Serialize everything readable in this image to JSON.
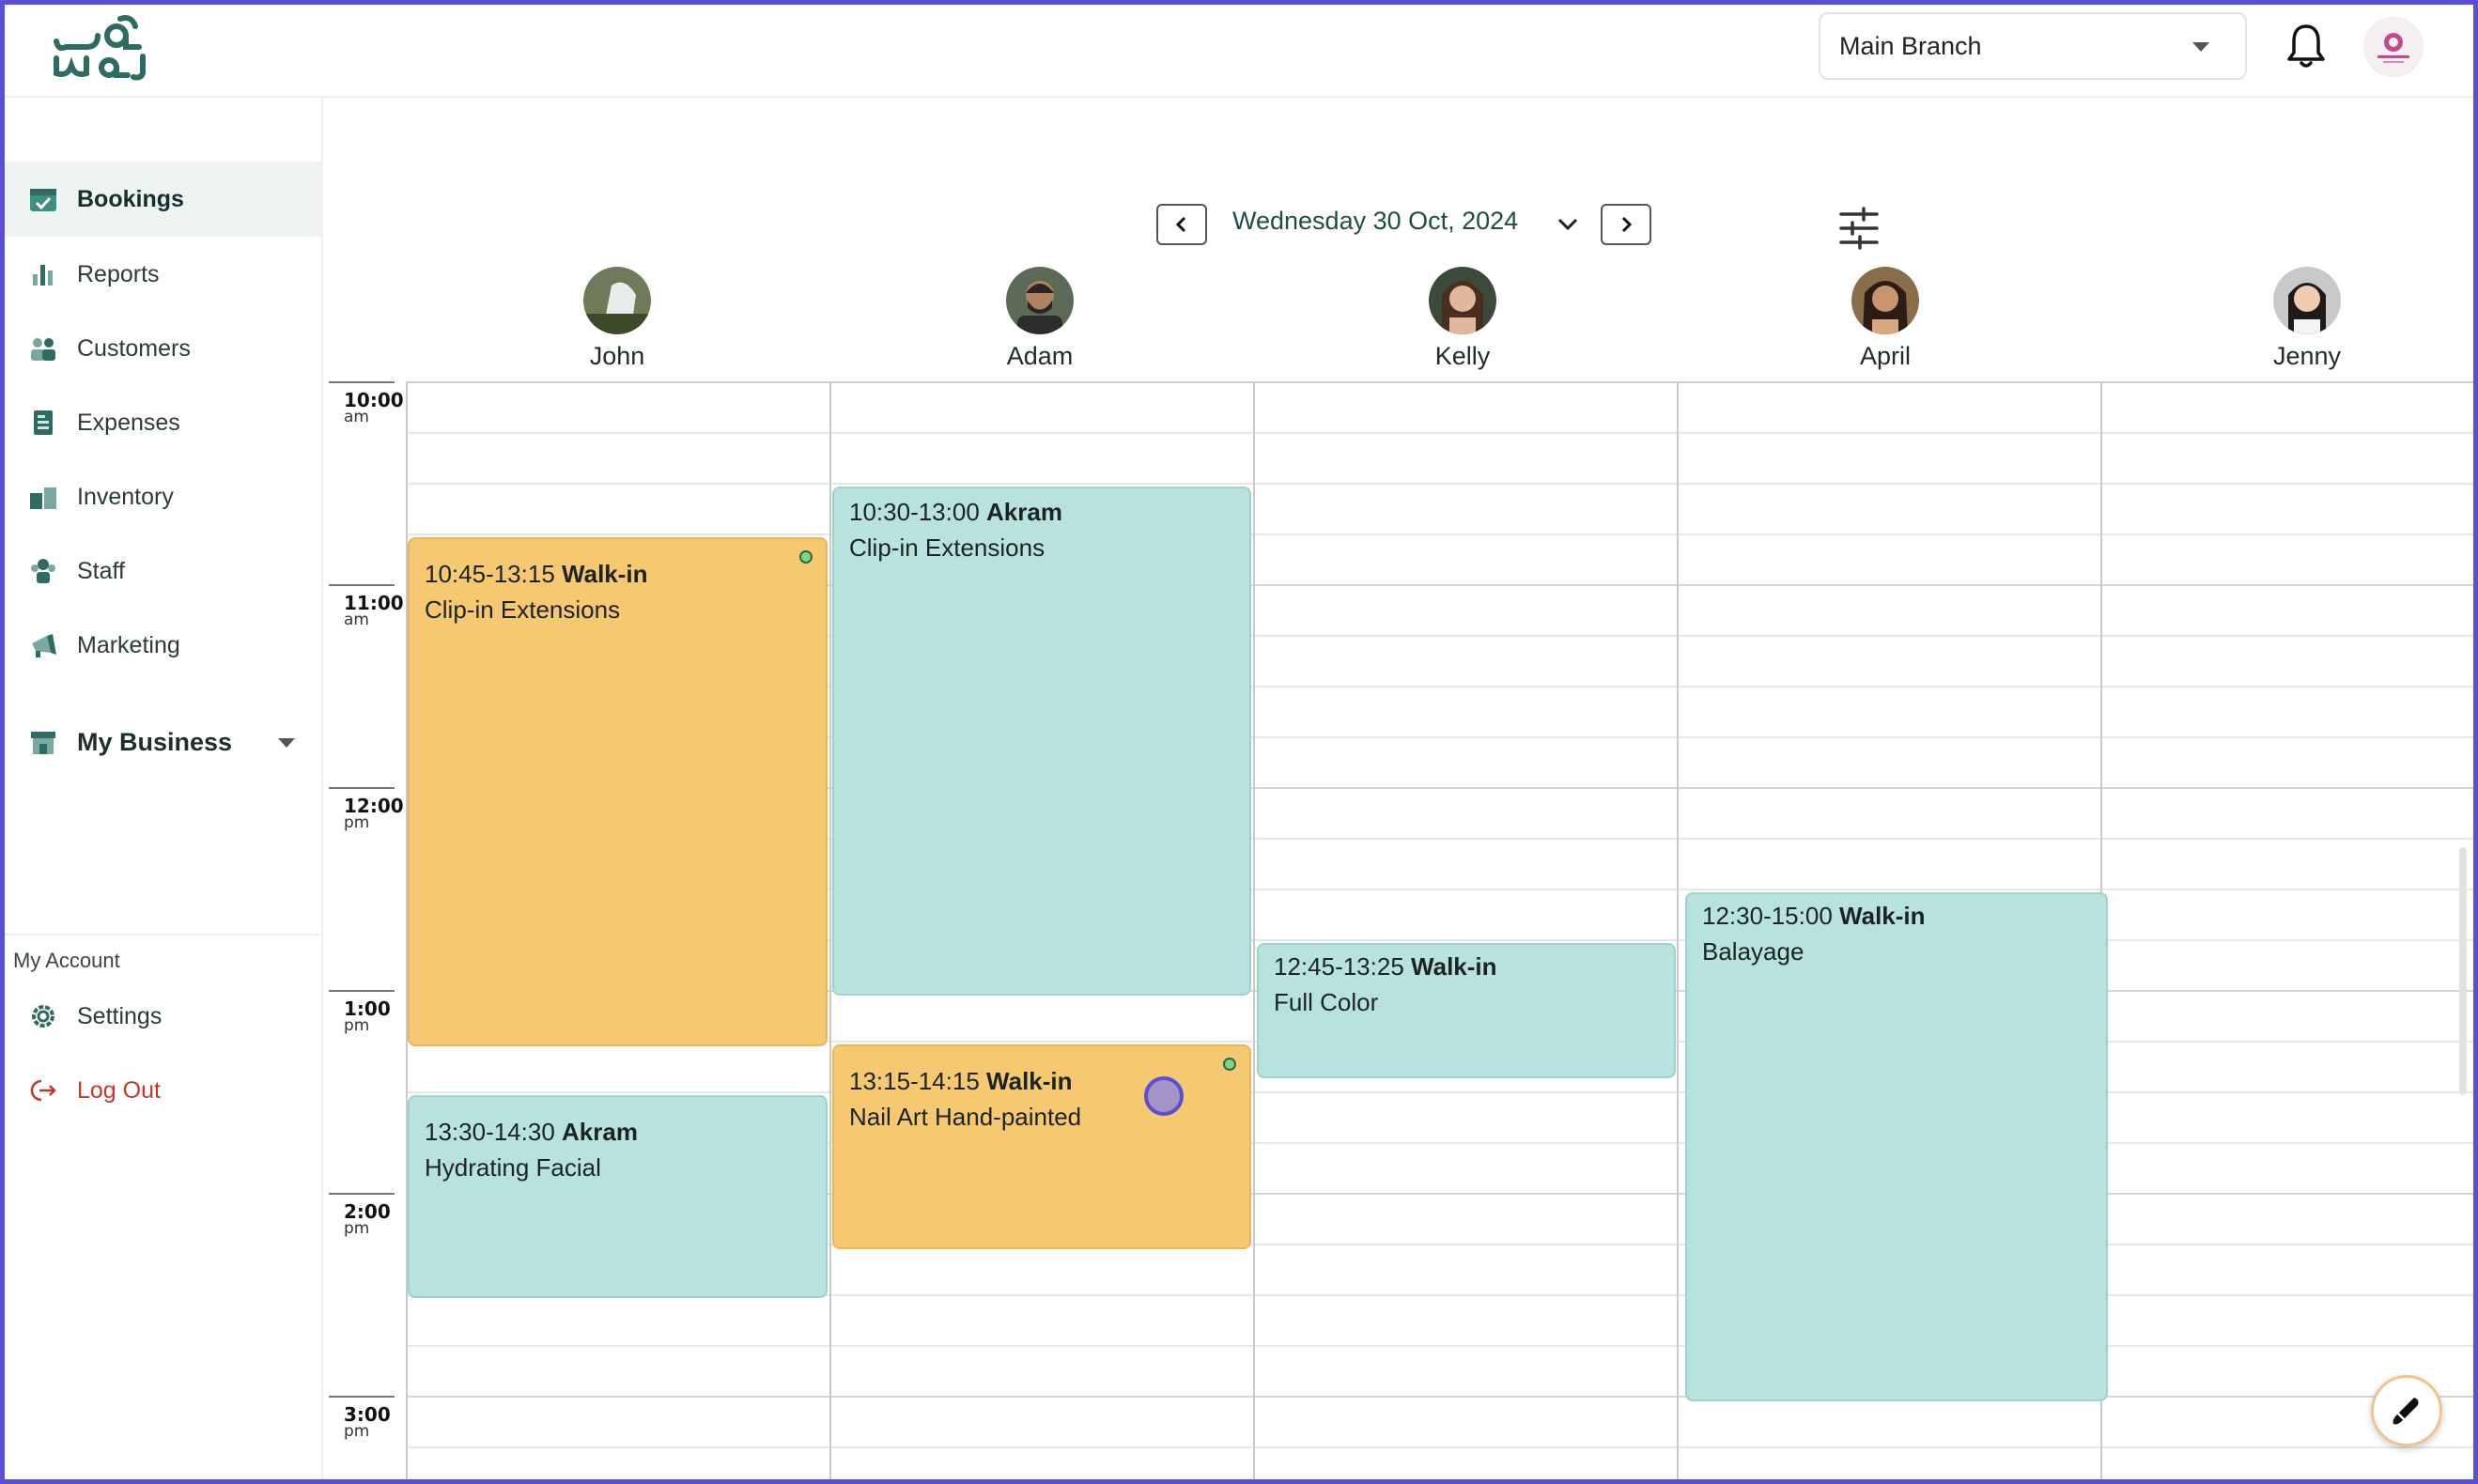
{
  "header": {
    "logo_alt": "logo",
    "branch_value": "Main Branch",
    "notifications_icon": "bell-icon",
    "account_icon": "account-avatar"
  },
  "sidebar": {
    "items": [
      {
        "label": "Bookings",
        "icon": "calendar-check-icon",
        "active": true
      },
      {
        "label": "Reports",
        "icon": "bar-chart-icon"
      },
      {
        "label": "Customers",
        "icon": "users-icon"
      },
      {
        "label": "Expenses",
        "icon": "receipt-icon"
      },
      {
        "label": "Inventory",
        "icon": "boxes-icon"
      },
      {
        "label": "Staff",
        "icon": "staff-icon"
      },
      {
        "label": "Marketing",
        "icon": "megaphone-icon"
      }
    ],
    "my_business": {
      "label": "My Business",
      "icon": "store-icon"
    },
    "account_section": "My Account",
    "settings": {
      "label": "Settings",
      "icon": "gear-icon"
    },
    "logout": {
      "label": "Log Out",
      "icon": "logout-icon"
    }
  },
  "calendar": {
    "date_label": "Wednesday 30 Oct, 2024",
    "staff": [
      {
        "name": "John"
      },
      {
        "name": "Adam"
      },
      {
        "name": "Kelly"
      },
      {
        "name": "April"
      },
      {
        "name": "Jenny"
      }
    ],
    "times": [
      {
        "t": "10:00",
        "m": "am"
      },
      {
        "t": "11:00",
        "m": "am"
      },
      {
        "t": "12:00",
        "m": "pm"
      },
      {
        "t": "1:00",
        "m": "pm"
      },
      {
        "t": "2:00",
        "m": "pm"
      },
      {
        "t": "3:00",
        "m": "pm"
      }
    ],
    "bookings": [
      {
        "range": "10:45-13:15",
        "who": "Walk-in",
        "service": "Clip-in Extensions",
        "staff": "John",
        "color": "#f6c86f"
      },
      {
        "range": "13:30-14:30",
        "who": "Akram",
        "service": "Hydrating Facial",
        "staff": "John",
        "color": "#b8e2de"
      },
      {
        "range": "10:30-13:00",
        "who": "Akram",
        "service": "Clip-in Extensions",
        "staff": "Adam",
        "color": "#b8e2de"
      },
      {
        "range": "13:15-14:15",
        "who": "Walk-in",
        "service": "Nail Art Hand-painted",
        "staff": "Adam",
        "color": "#f6c86f"
      },
      {
        "range": "12:45-13:25",
        "who": "Walk-in",
        "service": "Full Color",
        "staff": "Kelly",
        "color": "#b8e2de"
      },
      {
        "range": "12:30-15:00",
        "who": "Walk-in",
        "service": "Balayage",
        "staff": "April",
        "color": "#b8e2de"
      }
    ]
  },
  "colors": {
    "brand": "#1f6b5e",
    "frame": "#5b4fd6",
    "walk_in": "#f6c86f",
    "booked": "#b8e2de",
    "logout": "#c0392b"
  }
}
